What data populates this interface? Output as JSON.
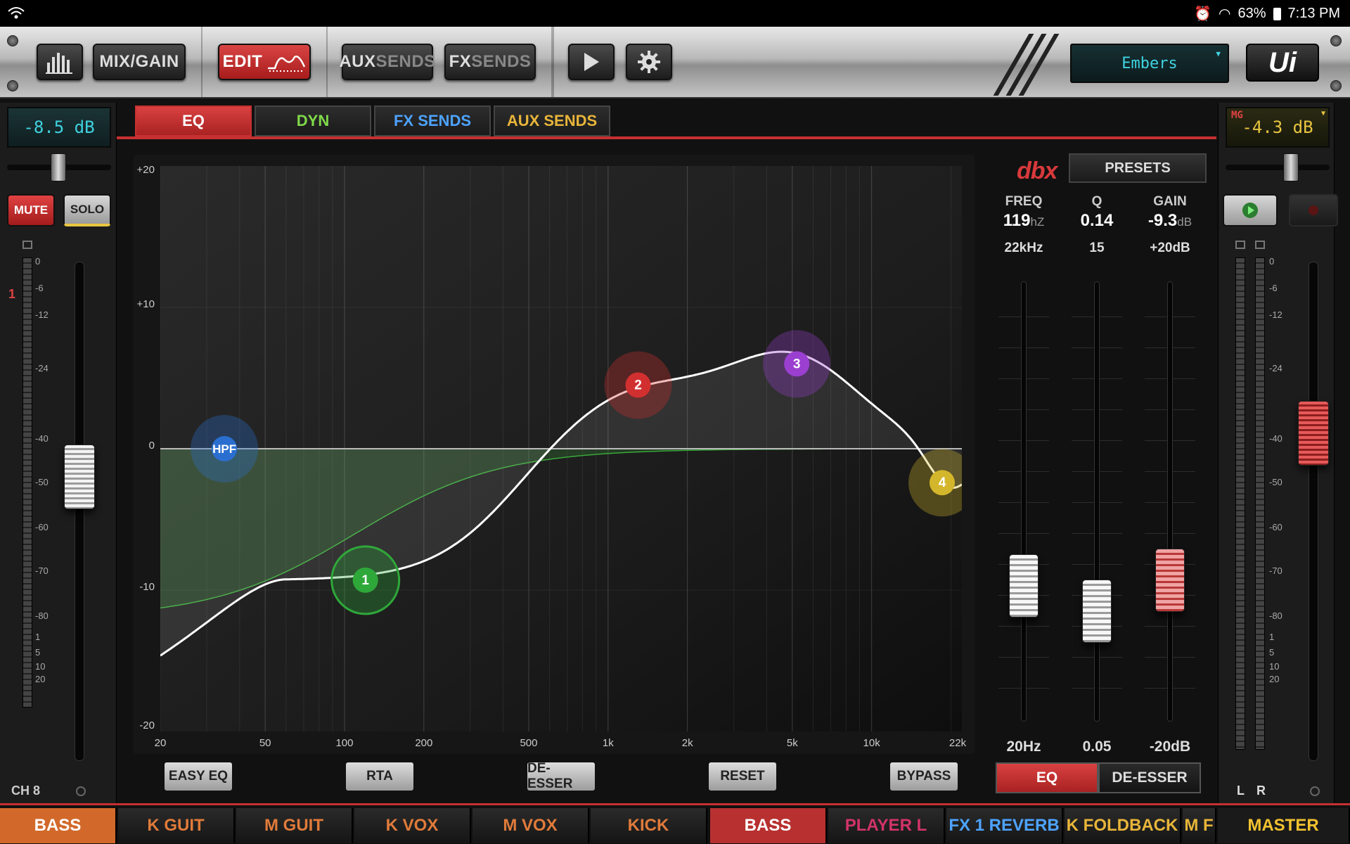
{
  "status_bar": {
    "battery": "63%",
    "time": "7:13 PM"
  },
  "toolbar": {
    "mix_gain": "MIX/GAIN",
    "edit": "EDIT",
    "aux_sends_a": "AUX",
    "aux_sends_b": "SENDS",
    "fx_sends_a": "FX",
    "fx_sends_b": "SENDS",
    "snapshot": "Embers",
    "logo": "Ui"
  },
  "left_strip": {
    "level": "-8.5 dB",
    "mute": "MUTE",
    "solo": "SOLO",
    "peak": "1",
    "channel": "CH 8",
    "scale": [
      "0",
      "-6",
      "-12",
      "-24",
      "-40",
      "-50",
      "-60",
      "-70",
      "-80",
      "1",
      "5",
      "10",
      "20"
    ]
  },
  "right_strip": {
    "tag": "MG",
    "level": "-4.3 dB",
    "left": "L",
    "right": "R",
    "scale": [
      "0",
      "-6",
      "-12",
      "-24",
      "-40",
      "-50",
      "-60",
      "-70",
      "-80",
      "1",
      "5",
      "10",
      "20"
    ]
  },
  "tabs": [
    {
      "label": "EQ",
      "color": "#ffffff"
    },
    {
      "label": "DYN",
      "color": "#7fd94a"
    },
    {
      "label": "FX SENDS",
      "color": "#4da3ff"
    },
    {
      "label": "AUX SENDS",
      "color": "#e8b53a"
    }
  ],
  "eq": {
    "y_labels": [
      "+20",
      "+10",
      "0",
      "-10",
      "-20"
    ],
    "x_labels": [
      "20",
      "50",
      "100",
      "200",
      "500",
      "1k",
      "2k",
      "5k",
      "10k",
      "22k"
    ],
    "nodes": [
      {
        "label": "HPF",
        "freq": 35,
        "gain": 0,
        "color": "#2a6fd0"
      },
      {
        "label": "1",
        "freq": 120,
        "gain": -9.3,
        "color": "#2fa83a"
      },
      {
        "label": "2",
        "freq": 1300,
        "gain": 4.5,
        "color": "#d23030"
      },
      {
        "label": "3",
        "freq": 5200,
        "gain": 6,
        "color": "#9a3fd0"
      },
      {
        "label": "4",
        "freq": 20000,
        "gain": -2.4,
        "color": "#d4b62c"
      }
    ],
    "buttons": {
      "easy": "EASY EQ",
      "rta": "RTA",
      "deesser": "DE-ESSER",
      "reset": "RESET",
      "bypass": "BYPASS"
    }
  },
  "params": {
    "brand": "dbx",
    "presets": "PRESETS",
    "freq": {
      "label": "FREQ",
      "value": "119",
      "unit": "hZ",
      "max": "22kHz",
      "min": "20Hz"
    },
    "q": {
      "label": "Q",
      "value": "0.14",
      "unit": "",
      "max": "15",
      "min": "0.05"
    },
    "gain": {
      "label": "GAIN",
      "value": "-9.3",
      "unit": "dB",
      "max": "+20dB",
      "min": "-20dB"
    },
    "mode_eq": "EQ",
    "mode_deesser": "DE-ESSER"
  },
  "channels": [
    {
      "label": "BASS",
      "color": "#ffffff",
      "bg": "#d2692a"
    },
    {
      "label": "K GUIT",
      "color": "#e07b3a"
    },
    {
      "label": "M GUIT",
      "color": "#e07b3a"
    },
    {
      "label": "K VOX",
      "color": "#e07b3a"
    },
    {
      "label": "M VOX",
      "color": "#e07b3a"
    },
    {
      "label": "KICK",
      "color": "#e07b3a"
    },
    {
      "label": "BASS",
      "color": "#ffffff",
      "bg": "#b83030"
    },
    {
      "label": "PLAYER L",
      "color": "#d2336a"
    },
    {
      "label": "FX 1 REVERB",
      "color": "#4da3ff"
    },
    {
      "label": "K FOLDBACK",
      "color": "#e8b53a"
    },
    {
      "label": "M F",
      "color": "#e8b53a"
    },
    {
      "label": "MASTER",
      "color": "#f2c230"
    }
  ]
}
